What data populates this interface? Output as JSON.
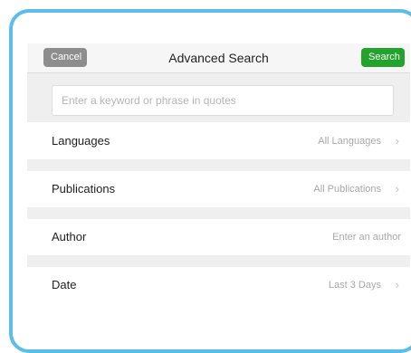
{
  "navbar": {
    "cancel_label": "Cancel",
    "title": "Advanced Search",
    "search_label": "Search"
  },
  "search": {
    "placeholder": "Enter a keyword or phrase in quotes",
    "value": ""
  },
  "rows": [
    {
      "label": "Languages",
      "value": "All Languages",
      "icon": "chevron-right-icon"
    },
    {
      "label": "Publications",
      "value": "All Publications",
      "icon": "chevron-right-icon"
    },
    {
      "label": "Author",
      "value": "Enter an author"
    },
    {
      "label": "Date",
      "value": "Last 3 Days",
      "icon": "chevron-right-icon"
    }
  ],
  "icons": {
    "chevron": "›"
  },
  "colors": {
    "frame": "#5cbde8",
    "cancel": "#8d8d8d",
    "search": "#23a32e",
    "section_bg": "#efefef"
  }
}
